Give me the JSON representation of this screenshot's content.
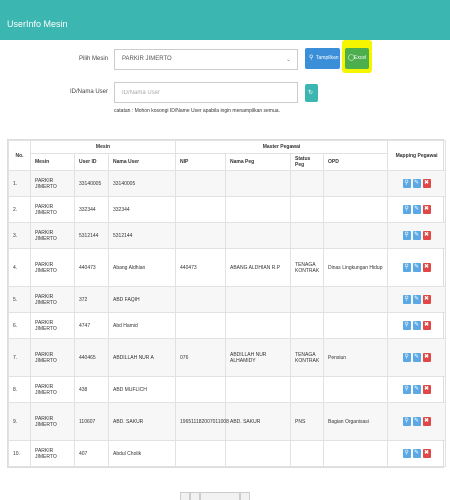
{
  "header": {
    "title": "UserInfo Mesin"
  },
  "form": {
    "mesin_label": "Pilih Mesin",
    "mesin_value": "PARKIR JIMERTO",
    "user_label": "ID/Nama User",
    "user_placeholder": "ID/Nama User",
    "tampilkan_label": "Tampilkan",
    "excel_label": "Excel",
    "note": "catatan : Mohon kosongi ID/Name User apabila ingin menampilkan semua."
  },
  "table": {
    "group_headers": {
      "no": "No.",
      "mesin": "Mesin",
      "master": "Master Pegawai",
      "mapping": "Mapping Pegawai"
    },
    "columns": [
      "Mesin",
      "User ID",
      "Nama User",
      "NIP",
      "Nama Peg",
      "Status Peg",
      "OPD"
    ],
    "rows": [
      {
        "no": "1.",
        "mesin": "PARKIR JIMERTO",
        "user_id": "33140005",
        "nama_user": "33140005",
        "nip": "",
        "nama_peg": "",
        "status": "",
        "opd": ""
      },
      {
        "no": "2.",
        "mesin": "PARKIR JIMERTO",
        "user_id": "332344",
        "nama_user": "332344",
        "nip": "",
        "nama_peg": "",
        "status": "",
        "opd": ""
      },
      {
        "no": "3.",
        "mesin": "PARKIR JIMERTO",
        "user_id": "5312144",
        "nama_user": "5312144",
        "nip": "",
        "nama_peg": "",
        "status": "",
        "opd": ""
      },
      {
        "no": "4.",
        "mesin": "PARKIR JIMERTO",
        "user_id": "440473",
        "nama_user": "Abang Aldhian",
        "nip": "440473",
        "nama_peg": "ABANG ALDHIAN R.P",
        "status": "TENAGA KONTRAK",
        "opd": "Dinas Lingkungan Hidup"
      },
      {
        "no": "5.",
        "mesin": "PARKIR JIMERTO",
        "user_id": "372",
        "nama_user": "ABD FAQIH",
        "nip": "",
        "nama_peg": "",
        "status": "",
        "opd": ""
      },
      {
        "no": "6.",
        "mesin": "PARKIR JIMERTO",
        "user_id": "4747",
        "nama_user": "Abd Hamid",
        "nip": "",
        "nama_peg": "",
        "status": "",
        "opd": ""
      },
      {
        "no": "7.",
        "mesin": "PARKIR JIMERTO",
        "user_id": "440465",
        "nama_user": "ABDILLAH NUR A",
        "nip": "076",
        "nama_peg": "ABDILLAH NUR ALHAMIDY",
        "status": "TENAGA KONTRAK",
        "opd": "Pensiun"
      },
      {
        "no": "8.",
        "mesin": "PARKIR JIMERTO",
        "user_id": "438",
        "nama_user": "ABD MUFLICH",
        "nip": "",
        "nama_peg": "",
        "status": "",
        "opd": ""
      },
      {
        "no": "9.",
        "mesin": "PARKIR JIMERTO",
        "user_id": "110607",
        "nama_user": "ABD. SAKUR",
        "nip": "196511182007011008",
        "nama_peg": "ABD. SAKUR",
        "status": "PNS",
        "opd": "Bagian Organisasi"
      },
      {
        "no": "10.",
        "mesin": "PARKIR JIMERTO",
        "user_id": "407",
        "nama_user": "Abdul Cholik",
        "nip": "",
        "nama_peg": "",
        "status": "",
        "opd": ""
      }
    ]
  },
  "icons": {
    "search": "search-icon",
    "edit": "edit-icon",
    "delete": "delete-icon",
    "refresh": "refresh-icon",
    "excel": "excel-icon",
    "caret": "chevron-down-icon"
  },
  "colors": {
    "header": "#3cb6b0",
    "primary": "#3b8fd9",
    "success": "#4cae4c",
    "danger": "#e04848",
    "highlight": "#f5f500"
  }
}
